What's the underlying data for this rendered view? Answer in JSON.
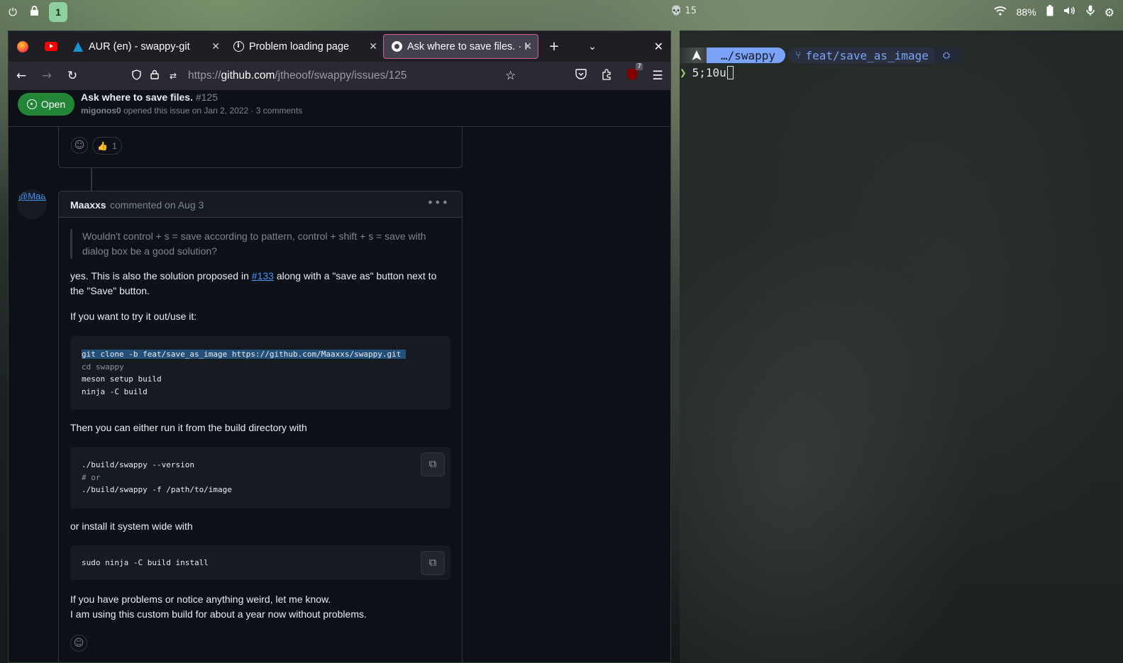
{
  "topbar": {
    "workspace": "1",
    "center_text": "💀 15",
    "battery": "88%",
    "icons": [
      "power-icon",
      "lock-icon",
      "wifi-icon",
      "battery-icon",
      "volume-icon",
      "microphone-icon",
      "settings-icon"
    ]
  },
  "browser": {
    "tabs": [
      {
        "title": "AUR (en) - swappy-git",
        "favicon": "arch-linux-icon"
      },
      {
        "title": "Problem loading page",
        "favicon": "info-icon"
      },
      {
        "title": "Ask where to save files. · I",
        "favicon": "github-icon",
        "active": true
      }
    ],
    "pinned_tabs": [
      "firefox-icon",
      "youtube-icon"
    ],
    "url": {
      "prefix": "https://",
      "host": "github.com",
      "path": "/jtheoof/swappy/issues/125"
    },
    "ublock_count": "7"
  },
  "issue": {
    "state": "Open",
    "title": "Ask where to save files.",
    "number": "#125",
    "author": "migonos0",
    "meta": " opened this issue on Jan 2, 2022 · 3 comments",
    "prev_reaction_count": "1"
  },
  "comment": {
    "avatar_alt": "@Maaxxs",
    "author": "Maaxxs",
    "when": "commented on Aug 3",
    "quote": "Wouldn't control + s = save according to pattern, control + shift + s = save with dialog box be a good solution?",
    "p1_before": "yes. This is also the solution proposed in ",
    "p1_link": "#133",
    "p1_after": " along with a \"save as\" button next to the \"Save\" button.",
    "p2": "If you want to try it out/use it:",
    "code1": [
      "git clone -b feat/save_as_image https://github.com/Maaxxs/swappy.git ",
      "cd swappy",
      "meson setup build",
      "ninja -C build"
    ],
    "p3": "Then you can either run it from the build directory with",
    "code2": [
      "./build/swappy --version",
      "# or",
      "./build/swappy -f /path/to/image"
    ],
    "p4": "or install it system wide with",
    "code3": [
      "sudo ninja -C build install"
    ],
    "p5_line1": "If you have problems or notice anything weird, let me know.",
    "p5_line2": "I am using this custom build for about a year now without problems."
  },
  "terminal": {
    "dir": "…/swappy",
    "branch": "feat/save_as_image",
    "input": "5;10u"
  }
}
